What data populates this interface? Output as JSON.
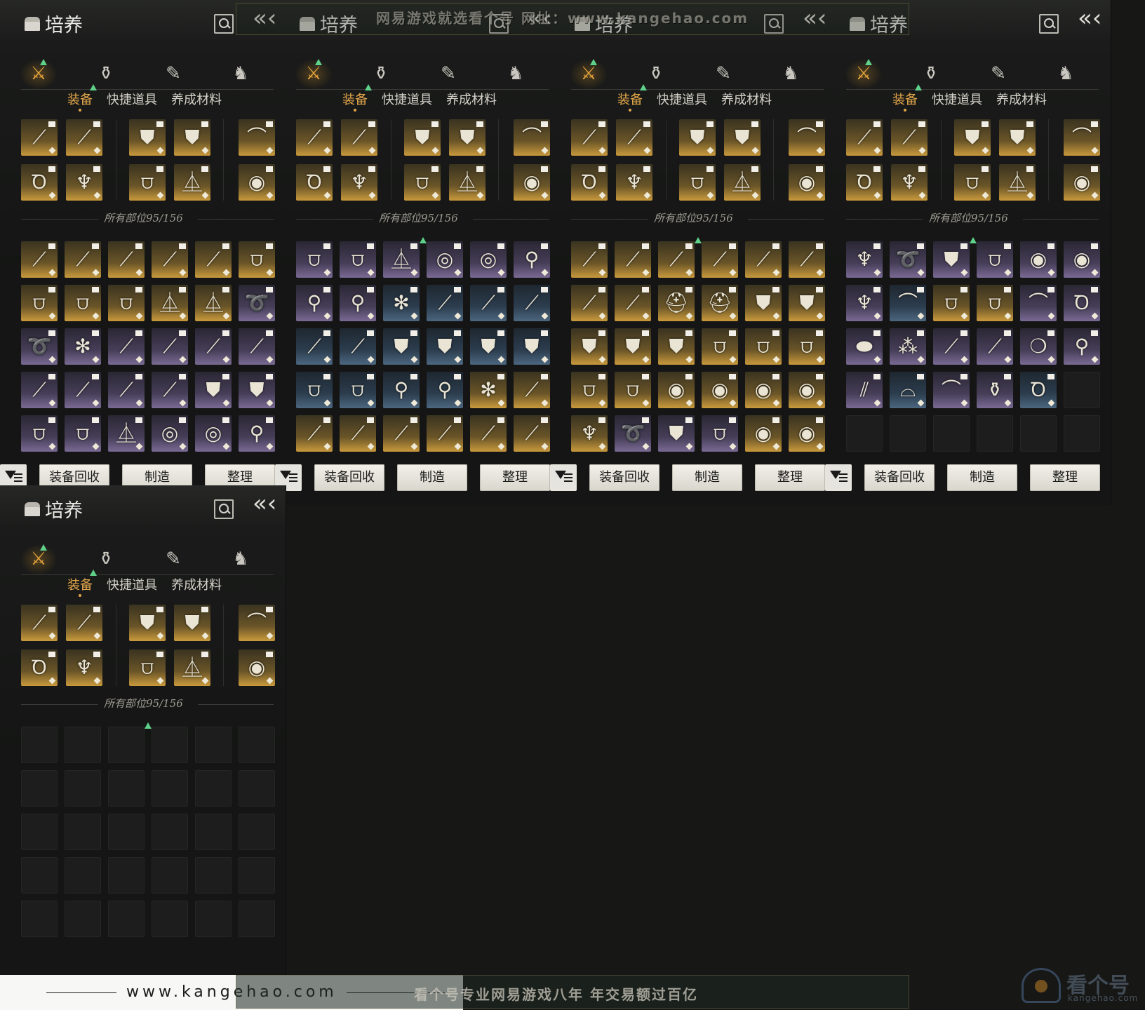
{
  "panel": {
    "title": "培养",
    "subtabs": [
      "装备",
      "快捷道具",
      "养成材料"
    ],
    "count_label": "所有部位95/156",
    "buttons": {
      "recycle": "装备回收",
      "craft": "制造",
      "sort": "整理"
    },
    "categories": [
      "crossed-swords-icon",
      "pouch-icon",
      "scroll-icon",
      "hat-icon"
    ]
  },
  "watermark": {
    "top_banner": "网易游戏就选看个号   网址：www.kangehao.com",
    "bottom_banner": "看个号专业网易游戏八年   年交易额过百亿",
    "site": "www.kangehao.com",
    "logo_name": "看个号",
    "logo_url": "kangehao.com"
  },
  "colors": {
    "accent": "#e5a63c",
    "new_marker": "#5fd08a",
    "gold_rarity": "#c99a3c",
    "purple_rarity": "#7a6a94",
    "blue_rarity": "#4c6780"
  },
  "equipped": [
    "sword",
    "sword",
    "armor",
    "armor",
    "bow",
    "ring",
    "pendant",
    "leggings",
    "horn",
    "bracelet"
  ],
  "grids": [
    [
      [
        "gold",
        "sword"
      ],
      [
        "gold",
        "sword"
      ],
      [
        "gold",
        "sword"
      ],
      [
        "gold",
        "sword"
      ],
      [
        "gold",
        "sword"
      ],
      [
        "gold",
        "leggings"
      ],
      [
        "gold",
        "leggings"
      ],
      [
        "gold",
        "leggings"
      ],
      [
        "gold",
        "leggings"
      ],
      [
        "gold",
        "horn"
      ],
      [
        "gold",
        "horn"
      ],
      [
        "purple",
        "rope"
      ],
      [
        "purple",
        "rope"
      ],
      [
        "purple",
        "fan"
      ],
      [
        "purple",
        "sword"
      ],
      [
        "purple",
        "sword"
      ],
      [
        "purple",
        "sword"
      ],
      [
        "purple",
        "sword"
      ],
      [
        "purple",
        "sword"
      ],
      [
        "purple",
        "sword"
      ],
      [
        "purple",
        "sword"
      ],
      [
        "purple",
        "sword"
      ],
      [
        "purple",
        "armor"
      ],
      [
        "purple",
        "armor"
      ],
      [
        "purple",
        "leggings"
      ],
      [
        "purple",
        "leggings"
      ],
      [
        "purple",
        "horn"
      ],
      [
        "purple",
        "disc"
      ],
      [
        "purple",
        "disc"
      ],
      [
        "purple",
        "tassel"
      ]
    ],
    [
      [
        "purple",
        "leggings"
      ],
      [
        "purple",
        "leggings"
      ],
      [
        "purple",
        "horn"
      ],
      [
        "purple",
        "disc"
      ],
      [
        "purple",
        "disc"
      ],
      [
        "purple",
        "tassel"
      ],
      [
        "purple",
        "tassel"
      ],
      [
        "purple",
        "tassel"
      ],
      [
        "blue",
        "fan"
      ],
      [
        "blue",
        "sword"
      ],
      [
        "blue",
        "sword"
      ],
      [
        "blue",
        "sword"
      ],
      [
        "blue",
        "sword"
      ],
      [
        "blue",
        "sword"
      ],
      [
        "blue",
        "armor"
      ],
      [
        "blue",
        "armor"
      ],
      [
        "blue",
        "armor"
      ],
      [
        "blue",
        "armor"
      ],
      [
        "blue",
        "leggings"
      ],
      [
        "blue",
        "leggings"
      ],
      [
        "blue",
        "tassel"
      ],
      [
        "blue",
        "tassel"
      ],
      [
        "gold",
        "fan"
      ],
      [
        "gold",
        "spear"
      ],
      [
        "gold",
        "spear"
      ],
      [
        "gold",
        "spear"
      ],
      [
        "gold",
        "spear"
      ],
      [
        "gold",
        "spear"
      ],
      [
        "gold",
        "spear"
      ],
      [
        "gold",
        "spear"
      ]
    ],
    [
      [
        "gold",
        "spear"
      ],
      [
        "gold",
        "spear"
      ],
      [
        "gold",
        "spear"
      ],
      [
        "gold",
        "spear"
      ],
      [
        "gold",
        "spear"
      ],
      [
        "gold",
        "spear"
      ],
      [
        "gold",
        "spear"
      ],
      [
        "gold",
        "spear"
      ],
      [
        "gold",
        "helmet"
      ],
      [
        "gold",
        "helmet"
      ],
      [
        "gold",
        "armor"
      ],
      [
        "gold",
        "armor"
      ],
      [
        "gold",
        "armor"
      ],
      [
        "gold",
        "armor"
      ],
      [
        "gold",
        "armor"
      ],
      [
        "gold",
        "leggings"
      ],
      [
        "gold",
        "leggings"
      ],
      [
        "gold",
        "leggings"
      ],
      [
        "gold",
        "leggings"
      ],
      [
        "gold",
        "leggings"
      ],
      [
        "gold",
        "bracelet"
      ],
      [
        "gold",
        "bracelet"
      ],
      [
        "gold",
        "bracelet"
      ],
      [
        "gold",
        "bracelet"
      ],
      [
        "gold",
        "pendant"
      ],
      [
        "purple",
        "rope"
      ],
      [
        "purple",
        "armor"
      ],
      [
        "purple",
        "leggings"
      ],
      [
        "gold",
        "bracelet"
      ],
      [
        "gold",
        "bracelet"
      ]
    ],
    [
      [
        "purple",
        "pendant"
      ],
      [
        "purple",
        "rope"
      ],
      [
        "purple",
        "armor"
      ],
      [
        "purple",
        "leggings"
      ],
      [
        "purple",
        "bracelet"
      ],
      [
        "purple",
        "bracelet"
      ],
      [
        "purple",
        "pendant"
      ],
      [
        "blue",
        "bow"
      ],
      [
        "gold",
        "leggings"
      ],
      [
        "gold",
        "leggings"
      ],
      [
        "purple",
        "bow"
      ],
      [
        "purple",
        "ring"
      ],
      [
        "purple",
        "stone"
      ],
      [
        "purple",
        "grapes"
      ],
      [
        "purple",
        "sword"
      ],
      [
        "purple",
        "sword"
      ],
      [
        "purple",
        "jade"
      ],
      [
        "purple",
        "tassel"
      ],
      [
        "purple",
        "bracer"
      ],
      [
        "blue",
        "hood"
      ],
      [
        "purple",
        "bow"
      ],
      [
        "purple",
        "pouch"
      ],
      [
        "blue",
        "ring"
      ],
      [
        "empty",
        ""
      ],
      [
        "empty",
        ""
      ],
      [
        "empty",
        ""
      ],
      [
        "empty",
        ""
      ],
      [
        "empty",
        ""
      ],
      [
        "empty",
        ""
      ],
      [
        "empty",
        ""
      ]
    ],
    [
      [
        "empty",
        ""
      ],
      [
        "empty",
        ""
      ],
      [
        "empty",
        ""
      ],
      [
        "empty",
        ""
      ],
      [
        "empty",
        ""
      ],
      [
        "empty",
        ""
      ],
      [
        "empty",
        ""
      ],
      [
        "empty",
        ""
      ],
      [
        "empty",
        ""
      ],
      [
        "empty",
        ""
      ],
      [
        "empty",
        ""
      ],
      [
        "empty",
        ""
      ],
      [
        "empty",
        ""
      ],
      [
        "empty",
        ""
      ],
      [
        "empty",
        ""
      ],
      [
        "empty",
        ""
      ],
      [
        "empty",
        ""
      ],
      [
        "empty",
        ""
      ],
      [
        "empty",
        ""
      ],
      [
        "empty",
        ""
      ],
      [
        "empty",
        ""
      ],
      [
        "empty",
        ""
      ],
      [
        "empty",
        ""
      ],
      [
        "empty",
        ""
      ],
      [
        "empty",
        ""
      ],
      [
        "empty",
        ""
      ],
      [
        "empty",
        ""
      ],
      [
        "empty",
        ""
      ],
      [
        "empty",
        ""
      ],
      [
        "empty",
        ""
      ]
    ]
  ]
}
